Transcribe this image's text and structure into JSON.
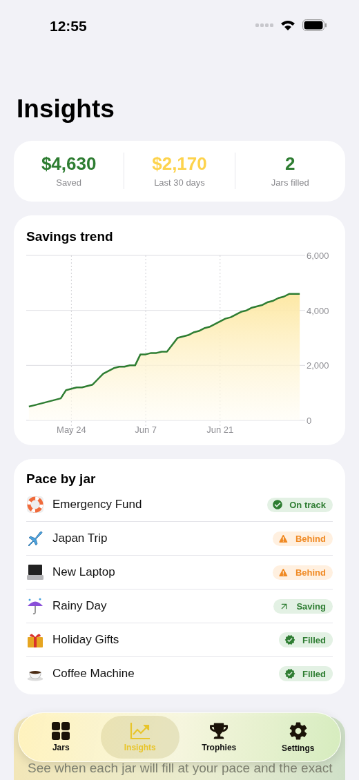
{
  "status_bar": {
    "time": "12:55"
  },
  "title": "Insights",
  "stats": [
    {
      "value": "$4,630",
      "label": "Saved",
      "color": "#2e7d32"
    },
    {
      "value": "$2,170",
      "label": "Last 30 days",
      "color": "#fdd34d"
    },
    {
      "value": "2",
      "label": "Jars filled",
      "color": "#2e7d32"
    }
  ],
  "savings_trend": {
    "title": "Savings trend",
    "chart_data": {
      "type": "area",
      "categories": [
        null,
        null,
        null,
        null,
        null,
        null,
        null,
        null,
        "May 24",
        null,
        null,
        null,
        null,
        null,
        null,
        null,
        null,
        null,
        null,
        null,
        null,
        null,
        "Jun 7",
        null,
        null,
        null,
        null,
        null,
        null,
        null,
        null,
        null,
        null,
        null,
        null,
        null,
        "Jun 21",
        null,
        null,
        null,
        null,
        null,
        null,
        null,
        null,
        null,
        null,
        null,
        null,
        null,
        null,
        null
      ],
      "series": [
        {
          "color": "#2e7d32",
          "values": [
            500,
            550,
            600,
            650,
            700,
            750,
            800,
            1100,
            1150,
            1200,
            1200,
            1250,
            1300,
            1500,
            1700,
            1800,
            1900,
            1950,
            1950,
            2000,
            2000,
            2400,
            2400,
            2450,
            2450,
            2500,
            2500,
            2750,
            3000,
            3050,
            3100,
            3200,
            3250,
            3350,
            3400,
            3500,
            3600,
            3700,
            3750,
            3850,
            3950,
            4000,
            4100,
            4150,
            4200,
            4300,
            4350,
            4450,
            4500,
            4600,
            4600,
            4600
          ]
        }
      ],
      "ylim": [
        0,
        6000
      ],
      "grid": true,
      "yticks": [
        {
          "value": 0,
          "label": "0"
        },
        {
          "value": 2000,
          "label": "2,000"
        },
        {
          "value": 4000,
          "label": "4,000"
        },
        {
          "value": 6000,
          "label": "6,000"
        }
      ]
    }
  },
  "pace": {
    "title": "Pace by jar",
    "jars": [
      {
        "name": "Emergency Fund",
        "status": "On track",
        "kind": "on_track"
      },
      {
        "name": "Japan Trip",
        "status": "Behind",
        "kind": "behind"
      },
      {
        "name": "New Laptop",
        "status": "Behind",
        "kind": "behind"
      },
      {
        "name": "Rainy Day",
        "status": "Saving",
        "kind": "saving"
      },
      {
        "name": "Holiday Gifts",
        "status": "Filled",
        "kind": "filled"
      },
      {
        "name": "Coffee Machine",
        "status": "Filled",
        "kind": "filled"
      }
    ]
  },
  "forecast_card": {
    "description": "See when each jar will fill at your pace and the exact"
  },
  "tab_bar": [
    {
      "label": "Jars",
      "selected": false
    },
    {
      "label": "Insights",
      "selected": true
    },
    {
      "label": "Trophies",
      "selected": false
    },
    {
      "label": "Settings",
      "selected": false
    }
  ]
}
